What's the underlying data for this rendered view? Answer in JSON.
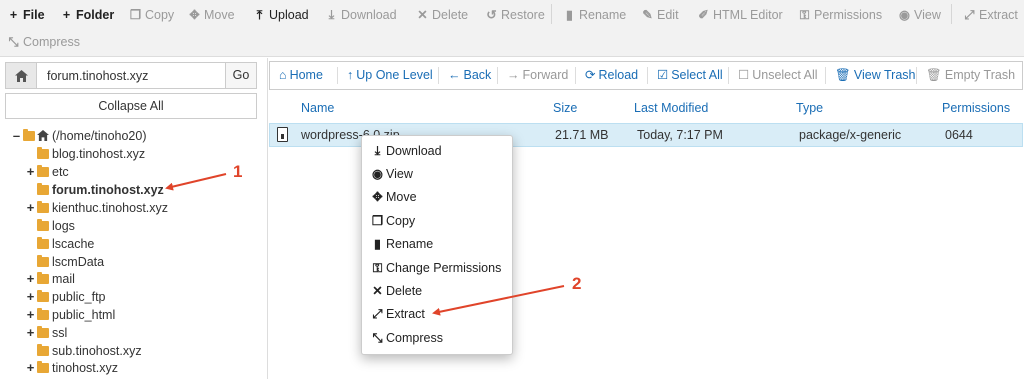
{
  "toolbar": {
    "file": "File",
    "folder": "Folder",
    "copy": "Copy",
    "move": "Move",
    "upload": "Upload",
    "download": "Download",
    "delete": "Delete",
    "restore": "Restore",
    "rename": "Rename",
    "edit": "Edit",
    "html_editor": "HTML Editor",
    "permissions": "Permissions",
    "view": "View",
    "extract": "Extract",
    "compress": "Compress"
  },
  "address": {
    "value": "forum.tinohost.xyz",
    "go": "Go"
  },
  "collapse_all": "Collapse All",
  "tree": {
    "root": "(/home/tinoho20)",
    "items": [
      {
        "label": "blog.tinohost.xyz"
      },
      {
        "label": "etc"
      },
      {
        "label": "forum.tinohost.xyz"
      },
      {
        "label": "kienthuc.tinohost.xyz"
      },
      {
        "label": "logs"
      },
      {
        "label": "lscache"
      },
      {
        "label": "lscmData"
      },
      {
        "label": "mail"
      },
      {
        "label": "public_ftp"
      },
      {
        "label": "public_html"
      },
      {
        "label": "ssl"
      },
      {
        "label": "sub.tinohost.xyz"
      },
      {
        "label": "tinohost.xyz"
      }
    ]
  },
  "nav": {
    "home": "Home",
    "up_one_level": "Up One Level",
    "back": "Back",
    "forward": "Forward",
    "reload": "Reload",
    "select_all": "Select All",
    "unselect_all": "Unselect All",
    "view_trash": "View Trash",
    "empty_trash": "Empty Trash"
  },
  "table": {
    "headers": {
      "name": "Name",
      "size": "Size",
      "last_modified": "Last Modified",
      "type": "Type",
      "permissions": "Permissions"
    },
    "rows": [
      {
        "name": "wordpress-6.0.zip",
        "size": "21.71 MB",
        "last_modified": "Today, 7:17 PM",
        "type": "package/x-generic",
        "permissions": "0644"
      }
    ]
  },
  "context_menu": {
    "download": "Download",
    "view": "View",
    "move": "Move",
    "copy": "Copy",
    "rename": "Rename",
    "change_permissions": "Change Permissions",
    "delete": "Delete",
    "extract": "Extract",
    "compress": "Compress"
  },
  "annotations": {
    "step1": "1",
    "step2": "2"
  },
  "colors": {
    "accent_link": "#1a6db5",
    "selected_row": "#d9edf7",
    "annotation": "#e0442a",
    "folder": "#e8a735"
  }
}
